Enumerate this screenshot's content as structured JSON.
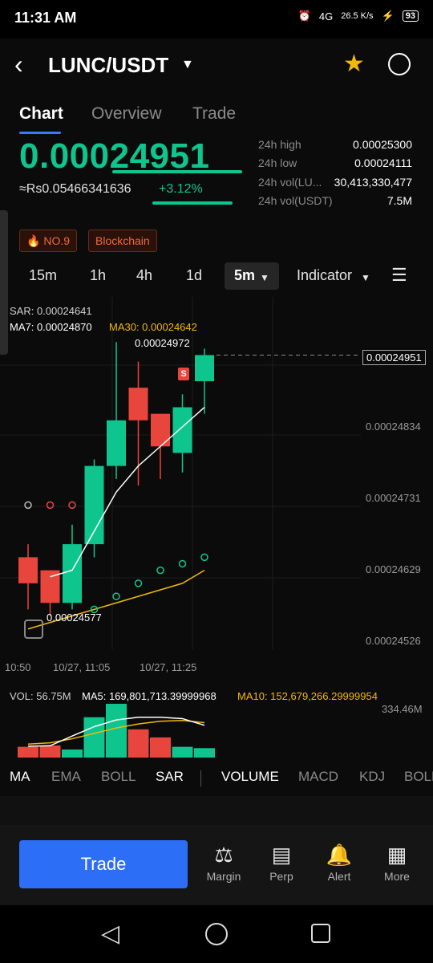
{
  "status": {
    "time": "11:31 AM",
    "net_speed": "26.5 K/s",
    "signal": "4G",
    "battery": "93"
  },
  "header": {
    "pair": "LUNC/USDT"
  },
  "tabs": [
    {
      "label": "Chart"
    },
    {
      "label": "Overview"
    },
    {
      "label": "Trade"
    }
  ],
  "ticker": {
    "price": "0.00024951",
    "fiat": "≈Rs0.05466341636",
    "change": "+3.12%",
    "stats": [
      {
        "label": "24h high",
        "value": "0.00025300"
      },
      {
        "label": "24h low",
        "value": "0.00024111"
      },
      {
        "label": "24h vol(LU...",
        "value": "30,413,330,477"
      },
      {
        "label": "24h vol(USDT)",
        "value": "7.5M"
      }
    ]
  },
  "badges": [
    {
      "label": "NO.9"
    },
    {
      "label": "Blockchain"
    }
  ],
  "timeframes": [
    {
      "label": "15m"
    },
    {
      "label": "1h"
    },
    {
      "label": "4h"
    },
    {
      "label": "1d"
    }
  ],
  "timeframe_active": "5m",
  "indicator_label": "Indicator",
  "chart": {
    "sar_label": "SAR: 0.00024641",
    "ma7_label": "MA7: 0.00024870",
    "ma30_label": "MA30: 0.00024642",
    "high_marker": "0.00024972",
    "low_marker": "0.00024577",
    "current_price_tag": "0.00024951",
    "y_ticks": [
      "0.00024834",
      "0.00024731",
      "0.00024629",
      "0.00024526"
    ],
    "x_ticks": [
      "10:50",
      "10/27, 11:05",
      "10/27, 11:25"
    ],
    "signal_label": "S",
    "colors": {
      "up": "#0fc58e",
      "down": "#e8453c",
      "ma30": "#f0b90b",
      "ma7": "#ffffff"
    }
  },
  "chart_data": {
    "type": "candlestick",
    "candles": [
      {
        "open": 0.0002464,
        "close": 0.000246,
        "high": 0.0002466,
        "low": 0.0002456
      },
      {
        "open": 0.0002462,
        "close": 0.0002457,
        "high": 0.0002462,
        "low": 0.0002455
      },
      {
        "open": 0.0002457,
        "close": 0.0002466,
        "high": 0.0002469,
        "low": 0.0002456
      },
      {
        "open": 0.0002466,
        "close": 0.0002478,
        "high": 0.0002479,
        "low": 0.0002464
      },
      {
        "open": 0.0002478,
        "close": 0.0002485,
        "high": 0.0002497,
        "low": 0.0002476
      },
      {
        "open": 0.000249,
        "close": 0.0002485,
        "high": 0.0002494,
        "low": 0.0002475
      },
      {
        "open": 0.0002486,
        "close": 0.0002481,
        "high": 0.0002486,
        "low": 0.0002476
      },
      {
        "open": 0.000248,
        "close": 0.0002487,
        "high": 0.0002489,
        "low": 0.0002477
      },
      {
        "open": 0.0002491,
        "close": 0.0002495,
        "high": 0.0002496,
        "low": 0.0002486
      }
    ],
    "ma7": [
      null,
      0.0002461,
      0.0002462,
      0.0002468,
      0.0002474,
      0.0002478,
      0.0002481,
      0.0002484,
      0.0002487
    ],
    "ma30": [
      0.0002453,
      0.0002454,
      0.0002455,
      0.0002456,
      0.0002457,
      0.0002458,
      0.0002459,
      0.000246,
      0.0002462
    ],
    "sar": [
      0.0002472,
      0.0002472,
      0.0002472,
      0.0002456,
      0.0002458,
      0.000246,
      0.0002462,
      0.0002463,
      0.0002464
    ],
    "ylim": [
      0.0002451,
      0.0002499
    ]
  },
  "volume": {
    "vol_label": "VOL: 56.75M",
    "ma5_label": "MA5: 169,801,713.39999968",
    "ma10_label": "MA10: 152,679,266.29999954",
    "max_label": "334.46M",
    "bars": [
      40,
      45,
      30,
      150,
      200,
      105,
      75,
      40,
      35
    ],
    "dirs": [
      "down",
      "down",
      "up",
      "up",
      "up",
      "down",
      "down",
      "up",
      "up"
    ],
    "ma5": [
      42,
      44,
      80,
      115,
      140,
      150,
      150,
      145,
      120
    ],
    "ma10": [
      50,
      55,
      70,
      90,
      110,
      125,
      135,
      138,
      130
    ]
  },
  "indicator_tabs": [
    "MA",
    "EMA",
    "BOLL",
    "SAR",
    "VOLUME",
    "MACD",
    "KDJ",
    "BOLL"
  ],
  "bottom": {
    "trade": "Trade",
    "nav": [
      {
        "label": "Margin",
        "icon": "margin-icon"
      },
      {
        "label": "Perp",
        "icon": "perp-icon"
      },
      {
        "label": "Alert",
        "icon": "bell-icon"
      },
      {
        "label": "More",
        "icon": "grid-icon"
      }
    ]
  }
}
